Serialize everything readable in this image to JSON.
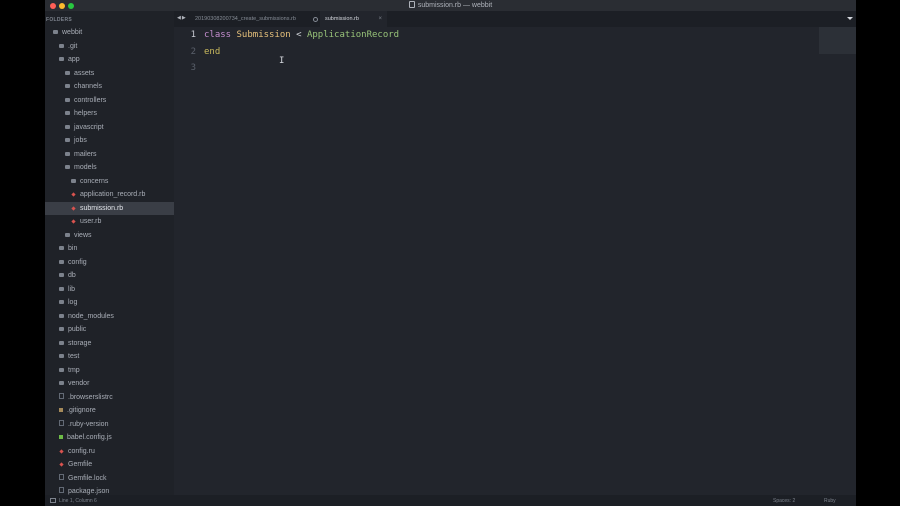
{
  "window": {
    "title": "submission.rb — webbit"
  },
  "sidebar": {
    "header": "FOLDERS",
    "items": [
      {
        "label": "webbit",
        "type": "folder-open",
        "indent": 0
      },
      {
        "label": ".git",
        "type": "folder",
        "indent": 1
      },
      {
        "label": "app",
        "type": "folder-open",
        "indent": 1
      },
      {
        "label": "assets",
        "type": "folder",
        "indent": 2
      },
      {
        "label": "channels",
        "type": "folder",
        "indent": 2
      },
      {
        "label": "controllers",
        "type": "folder",
        "indent": 2
      },
      {
        "label": "helpers",
        "type": "folder",
        "indent": 2
      },
      {
        "label": "javascript",
        "type": "folder",
        "indent": 2
      },
      {
        "label": "jobs",
        "type": "folder",
        "indent": 2
      },
      {
        "label": "mailers",
        "type": "folder",
        "indent": 2
      },
      {
        "label": "models",
        "type": "folder-open",
        "indent": 2
      },
      {
        "label": "concerns",
        "type": "folder",
        "indent": 3
      },
      {
        "label": "application_record.rb",
        "type": "ruby",
        "indent": 3
      },
      {
        "label": "submission.rb",
        "type": "ruby",
        "indent": 3,
        "selected": true
      },
      {
        "label": "user.rb",
        "type": "ruby",
        "indent": 3
      },
      {
        "label": "views",
        "type": "folder",
        "indent": 2
      },
      {
        "label": "bin",
        "type": "folder",
        "indent": 1
      },
      {
        "label": "config",
        "type": "folder",
        "indent": 1
      },
      {
        "label": "db",
        "type": "folder",
        "indent": 1
      },
      {
        "label": "lib",
        "type": "folder",
        "indent": 1
      },
      {
        "label": "log",
        "type": "folder",
        "indent": 1
      },
      {
        "label": "node_modules",
        "type": "folder",
        "indent": 1
      },
      {
        "label": "public",
        "type": "folder",
        "indent": 1
      },
      {
        "label": "storage",
        "type": "folder",
        "indent": 1
      },
      {
        "label": "test",
        "type": "folder",
        "indent": 1
      },
      {
        "label": "tmp",
        "type": "folder",
        "indent": 1
      },
      {
        "label": "vendor",
        "type": "folder",
        "indent": 1
      },
      {
        "label": ".browserslistrc",
        "type": "file",
        "indent": 1
      },
      {
        "label": ".gitignore",
        "type": "git",
        "indent": 1
      },
      {
        "label": ".ruby-version",
        "type": "file",
        "indent": 1
      },
      {
        "label": "babel.config.js",
        "type": "js",
        "indent": 1
      },
      {
        "label": "config.ru",
        "type": "ruby",
        "indent": 1
      },
      {
        "label": "Gemfile",
        "type": "ruby",
        "indent": 1
      },
      {
        "label": "Gemfile.lock",
        "type": "file",
        "indent": 1
      },
      {
        "label": "package.json",
        "type": "file",
        "indent": 1
      }
    ]
  },
  "tabs": [
    {
      "label": "20190308200734_create_submissions.rb",
      "active": false
    },
    {
      "label": "submission.rb",
      "active": true
    }
  ],
  "editor": {
    "line_numbers": [
      "1",
      "2",
      "3"
    ],
    "line1": {
      "kw": "class",
      "name": "Submission",
      "op": "<",
      "parent": "ApplicationRecord"
    },
    "line2": {
      "kw": "end"
    },
    "cursor_glyph": "I"
  },
  "statusbar": {
    "position": "Line 1, Column 6",
    "spaces": "Spaces: 2",
    "syntax": "Ruby"
  },
  "colors": {
    "keyword": "#c58ecf",
    "class_name": "#e5c07b",
    "superclass": "#98c379",
    "ruby_file": "#d9534f"
  }
}
